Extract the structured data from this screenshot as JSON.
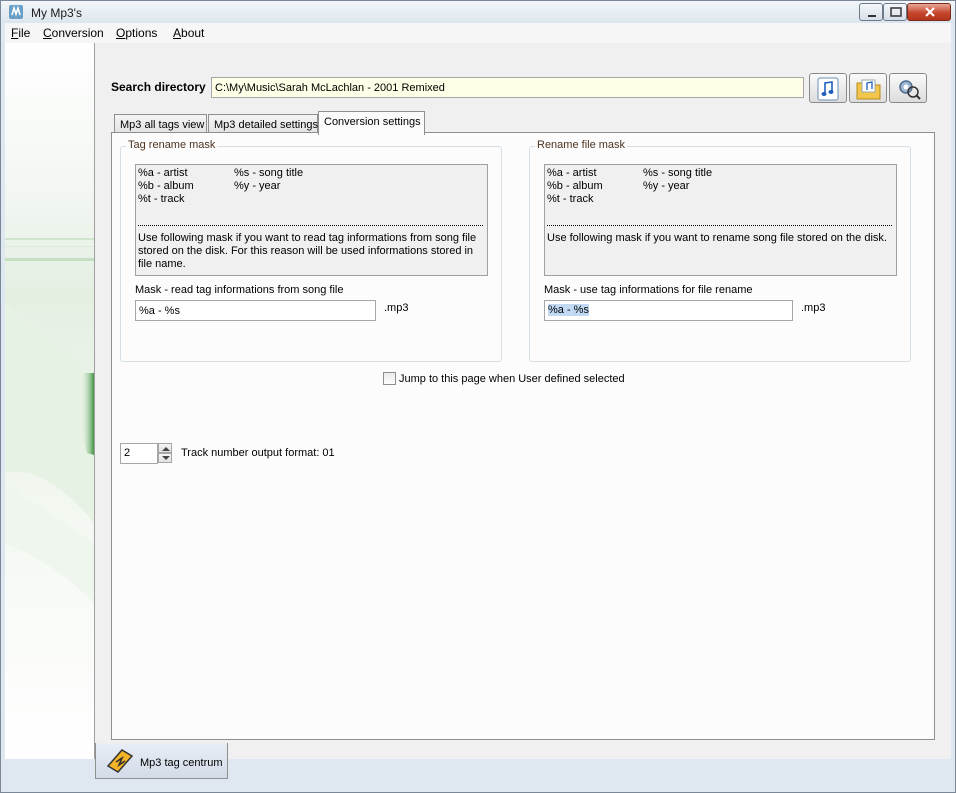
{
  "window": {
    "title": "My Mp3's"
  },
  "menu": {
    "file": {
      "mnemonic": "F",
      "rest": "ile"
    },
    "conversion": {
      "mnemonic": "C",
      "rest": "onversion"
    },
    "options": {
      "mnemonic": "O",
      "rest": "ptions"
    },
    "about": {
      "mnemonic": "A",
      "rest": "bout"
    }
  },
  "search": {
    "label": "Search directory",
    "value": "C:\\My\\Music\\Sarah McLachlan - 2001 Remixed"
  },
  "toolbar": {
    "icons": [
      "music-note-icon",
      "folder-music-icon",
      "settings-search-icon"
    ]
  },
  "tabs": [
    {
      "label": "Mp3 all tags view",
      "active": false
    },
    {
      "label": "Mp3 detailed settings",
      "active": false
    },
    {
      "label": "Conversion settings",
      "active": true
    }
  ],
  "tag_rename": {
    "title": "Tag rename mask",
    "legend": {
      "a": "%a - artist",
      "s": "%s - song title",
      "b": "%b - album",
      "y": "%y - year",
      "t": "%t - track"
    },
    "description": "Use following mask if you want to read tag informations from song file stored on the disk. For this reason will be used informations stored in file name.",
    "mask_label": "Mask - read tag informations from song file",
    "mask_value": "%a - %s",
    "ext": ".mp3"
  },
  "rename_file": {
    "title": "Rename file mask",
    "legend": {
      "a": "%a - artist",
      "s": "%s - song title",
      "b": "%b - album",
      "y": "%y - year",
      "t": "%t - track"
    },
    "description": "Use following mask if you want to rename song file stored on the disk.",
    "mask_label": "Mask - use tag informations for file rename",
    "mask_value": "%a - %s",
    "ext": ".mp3"
  },
  "jump_checkbox": {
    "label": "Jump to this page when User defined selected",
    "checked": false
  },
  "track_format": {
    "value": "2",
    "label": "Track number output format: 01"
  },
  "bottom_tab": {
    "label": "Mp3 tag centrum"
  },
  "colors": {
    "accent": "#c2d9f3",
    "group_title": "#4d3320",
    "search_bg": "#fffee6"
  }
}
